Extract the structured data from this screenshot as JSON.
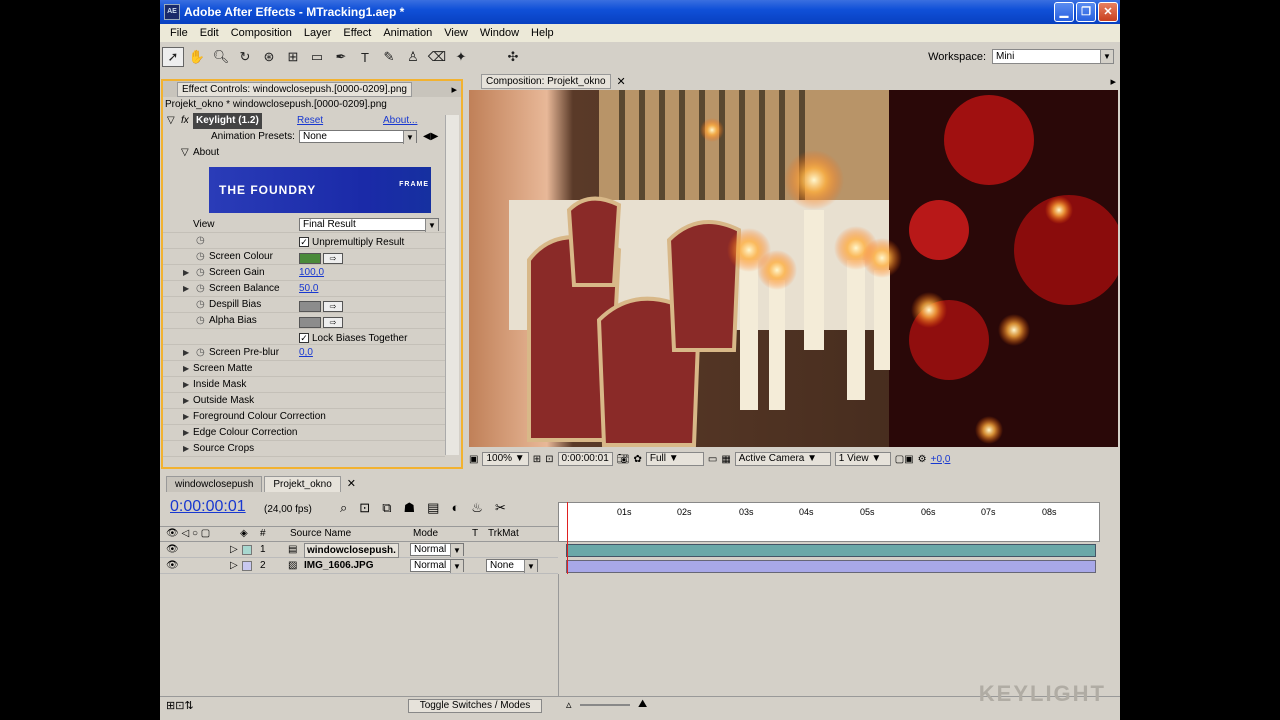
{
  "window": {
    "title": "Adobe After Effects - MTracking1.aep *",
    "app_icon": "AE"
  },
  "menu": [
    "File",
    "Edit",
    "Composition",
    "Layer",
    "Effect",
    "Animation",
    "View",
    "Window",
    "Help"
  ],
  "workspace": {
    "label": "Workspace:",
    "value": "Mini"
  },
  "effect_controls": {
    "tab": "Effect Controls: windowclosepush.[0000-0209].png",
    "subtitle": "Projekt_okno * windowclosepush.[0000-0209].png",
    "effect_name": "Keylight (1.2)",
    "reset": "Reset",
    "about": "About...",
    "presets_label": "Animation Presets:",
    "presets_value": "None",
    "about_section": "About",
    "logo_text": "THE FOUNDRY",
    "logo_side": "FRAME",
    "rows": {
      "view_label": "View",
      "view_value": "Final Result",
      "unpremultiply": "Unpremultiply Result",
      "screen_colour": "Screen Colour",
      "screen_gain": "Screen Gain",
      "screen_gain_value": "100,0",
      "screen_balance": "Screen Balance",
      "screen_balance_value": "50,0",
      "despill_bias": "Despill Bias",
      "alpha_bias": "Alpha Bias",
      "lock_biases": "Lock Biases Together",
      "screen_preblur": "Screen Pre-blur",
      "screen_preblur_value": "0,0",
      "screen_matte": "Screen Matte",
      "inside_mask": "Inside Mask",
      "outside_mask": "Outside Mask",
      "fg_colour": "Foreground Colour Correction",
      "edge_colour": "Edge Colour Correction",
      "source_crops": "Source Crops"
    },
    "colors": {
      "screen": "#4a8a3a",
      "gray": "#8c8c8c"
    }
  },
  "composition": {
    "tab": "Composition: Projekt_okno",
    "zoom": "100%",
    "timecode": "0:00:00:01",
    "resolution": "Full",
    "camera": "Active Camera",
    "views": "1 View",
    "exposure": "+0,0"
  },
  "timeline": {
    "tabs": [
      "windowclosepush",
      "Projekt_okno"
    ],
    "timecode": "0:00:00:01",
    "fps": "(24,00 fps)",
    "headers": {
      "num": "#",
      "source": "Source Name",
      "mode": "Mode",
      "t": "T",
      "trkmat": "TrkMat"
    },
    "layers": [
      {
        "num": "1",
        "name": "windowclosepush.",
        "mode": "Normal",
        "trkmat": ""
      },
      {
        "num": "2",
        "name": "IMG_1606.JPG",
        "mode": "Normal",
        "trkmat": "None"
      }
    ],
    "ticks": [
      "01s",
      "02s",
      "03s",
      "04s",
      "05s",
      "06s",
      "07s",
      "08s"
    ],
    "toggle": "Toggle Switches / Modes",
    "watermark": "KEYLIGHT"
  }
}
